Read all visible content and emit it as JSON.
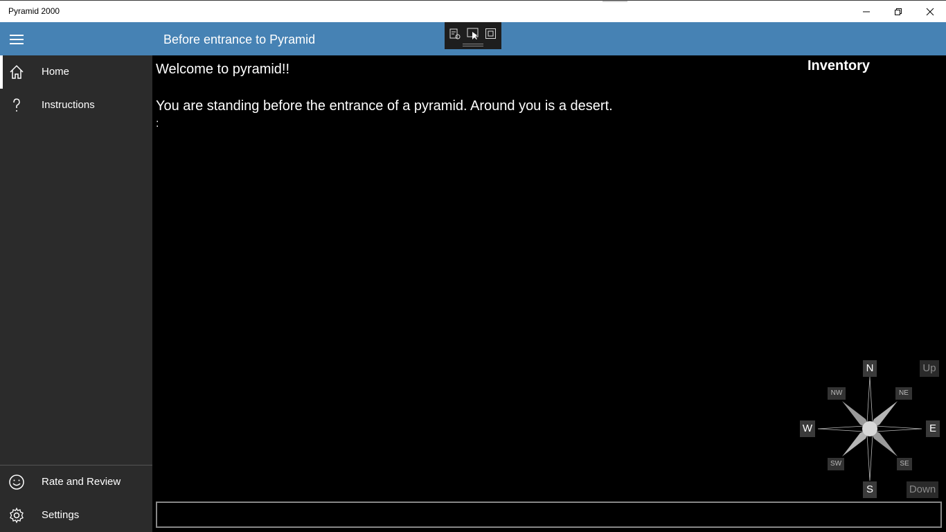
{
  "window": {
    "title": "Pyramid 2000"
  },
  "header": {
    "location_title": "Before entrance to Pyramid"
  },
  "sidebar": {
    "items": [
      {
        "label": "Home",
        "icon": "home-icon"
      },
      {
        "label": "Instructions",
        "icon": "question-icon"
      }
    ],
    "footer_items": [
      {
        "label": "Rate and Review",
        "icon": "smiley-icon"
      },
      {
        "label": "Settings",
        "icon": "gear-icon"
      }
    ]
  },
  "main": {
    "lines": [
      "Welcome to pyramid!!",
      "You are standing before the entrance of a pyramid.  Around you is a desert.",
      ":"
    ],
    "inventory_label": "Inventory",
    "command_value": ""
  },
  "compass": {
    "n": "N",
    "s": "S",
    "e": "E",
    "w": "W",
    "ne": "NE",
    "nw": "NW",
    "se": "SE",
    "sw": "SW",
    "up": "Up",
    "down": "Down"
  },
  "colors": {
    "header": "#4682b4",
    "sidebar": "#2b2b2b",
    "main_bg": "#000000"
  }
}
